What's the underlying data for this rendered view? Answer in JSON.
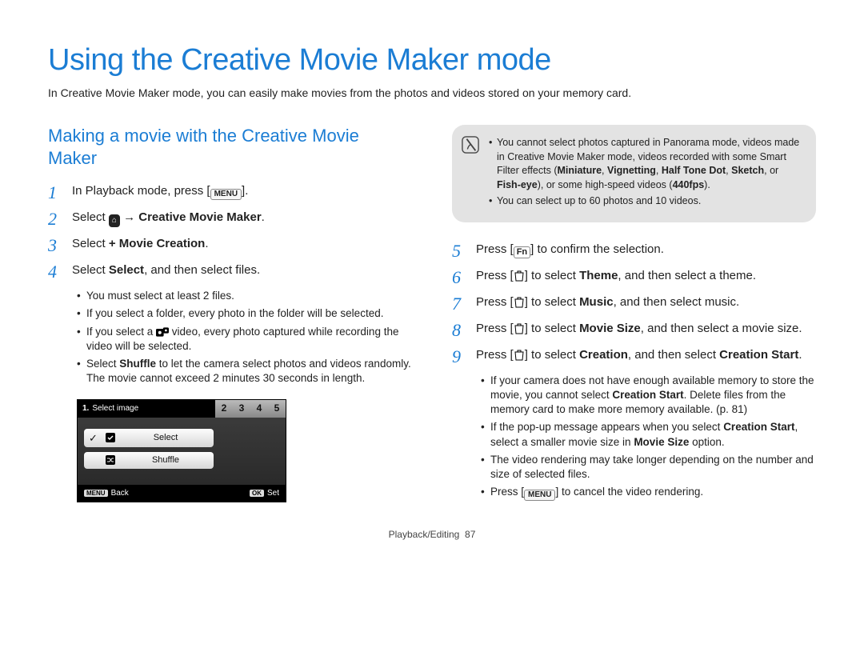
{
  "title": "Using the Creative Movie Maker mode",
  "intro": "In Creative Movie Maker mode, you can easily make movies from the photos and videos stored on your memory card.",
  "subhead": "Making a movie with the Creative Movie Maker",
  "icons": {
    "menu": "MENU",
    "mode": "⌂",
    "dual": "⧉",
    "fn": "Fn",
    "trash": "trash",
    "ok": "OK"
  },
  "left_steps": [
    {
      "n": "1",
      "html": "In Playback mode, press [<span class='glyph-box' data-name='menu-key-icon'>MENU</span>]."
    },
    {
      "n": "2",
      "html": "Select <span class='glyph-box filled' data-name='mode-icon'>⌂</span> → <b>Creative Movie Maker</b>."
    },
    {
      "n": "3",
      "html": "Select <b>+ Movie Creation</b>."
    },
    {
      "n": "4",
      "html": "Select <b>Select</b>, and then select files."
    }
  ],
  "left_bullets": [
    "You must select at least 2 files.",
    "If you select a folder, every photo in the folder will be selected.",
    "If you select a <span class='icon-face' data-name='dual-capture-icon'><svg viewBox='0 0 20 14'><rect x='0' y='2' width='12' height='12' rx='2' fill='#000'/><circle cx='6' cy='8' r='2.5' fill='#fff'/><rect x='11' y='0' width='9' height='9' rx='2' fill='#000'/><circle cx='15.5' cy='4.5' r='1.7' fill='#fff'/></svg></span> video, every photo captured while recording the video will be selected.",
    "Select <b>Shuffle</b> to let the camera select photos and videos randomly. The movie cannot exceed 2 minutes 30 seconds in length."
  ],
  "note": {
    "items": [
      "You cannot select photos captured in Panorama mode, videos made in Creative Movie Maker mode, videos recorded with some Smart Filter effects (<b>Miniature</b>, <b>Vignetting</b>, <b>Half Tone Dot</b>, <b>Sketch</b>, or <b>Fish-eye</b>), or some high-speed videos (<b>440fps</b>).",
      "You can select up to 60 photos and 10 videos."
    ]
  },
  "right_steps": [
    {
      "n": "5",
      "html": "Press [<span class='glyph-box fn' data-name='fn-key-icon'>Fn</span>] to confirm the selection."
    },
    {
      "n": "6",
      "html": "Press [<span class='icon-trash' data-name='trash-key-icon'><svg viewBox='0 0 14 14'><path d='M2 3h10l-1 10H3z M5 1h4v2H5z' fill='none' stroke='#000' stroke-width='1'/></svg></span>] to select <b>Theme</b>, and then select a theme."
    },
    {
      "n": "7",
      "html": "Press [<span class='icon-trash' data-name='trash-key-icon'><svg viewBox='0 0 14 14'><path d='M2 3h10l-1 10H3z M5 1h4v2H5z' fill='none' stroke='#000' stroke-width='1'/></svg></span>] to select <b>Music</b>, and then select music."
    },
    {
      "n": "8",
      "html": "Press [<span class='icon-trash' data-name='trash-key-icon'><svg viewBox='0 0 14 14'><path d='M2 3h10l-1 10H3z M5 1h4v2H5z' fill='none' stroke='#000' stroke-width='1'/></svg></span>] to select <b>Movie Size</b>, and then select a movie size."
    },
    {
      "n": "9",
      "html": "Press [<span class='icon-trash' data-name='trash-key-icon'><svg viewBox='0 0 14 14'><path d='M2 3h10l-1 10H3z M5 1h4v2H5z' fill='none' stroke='#000' stroke-width='1'/></svg></span>] to select <b>Creation</b>, and then select <b>Creation Start</b>."
    }
  ],
  "right_bullets": [
    "If your camera does not have enough available memory to store the movie, you cannot select <b>Creation Start</b>. Delete files from the memory card to make more memory available. (p. 81)",
    "If the pop-up message appears when you select <b>Creation Start</b>, select a smaller movie size in <b>Movie Size</b> option.",
    "The video rendering may take longer depending on the number and size of selected files.",
    "Press [<span class='glyph-box' data-name='menu-key-icon'>MENU</span>] to cancel the video rendering."
  ],
  "device": {
    "title_num": "1.",
    "title_text": "Select image",
    "tabs": [
      "2",
      "3",
      "4",
      "5"
    ],
    "opt1": "Select",
    "opt2": "Shuffle",
    "back_key": "MENU",
    "back_label": "Back",
    "set_key": "OK",
    "set_label": "Set"
  },
  "footer_section": "Playback/Editing",
  "footer_page": "87"
}
